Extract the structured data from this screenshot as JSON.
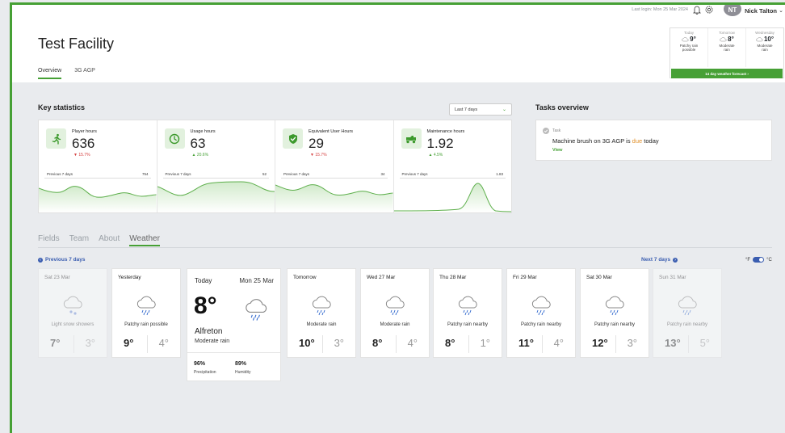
{
  "header": {
    "last_login": "Last login: Mon 25 Mar 2024",
    "avatar_initials": "NT",
    "user_name": "Nick Talton",
    "page_title": "Test Facility",
    "tabs": [
      {
        "label": "Overview"
      },
      {
        "label": "3G AGP"
      }
    ]
  },
  "weather_mini": {
    "days": [
      {
        "name": "Today",
        "temp": "9°",
        "desc1": "Patchy rain",
        "desc2": "possible"
      },
      {
        "name": "Tomorrow",
        "temp": "8°",
        "desc1": "Moderate",
        "desc2": "rain"
      },
      {
        "name": "Wednesday",
        "temp": "10°",
        "desc1": "Moderate",
        "desc2": "rain"
      }
    ],
    "forecast_button": "14 day weather forecast  ›"
  },
  "key_stats": {
    "title": "Key statistics",
    "period": "Last 7 days",
    "items": [
      {
        "label": "Player hours",
        "value": "636",
        "delta": "▼ 15.7%",
        "prev_label": "Previous 7 days",
        "prev_value": "754",
        "icon": "running-icon"
      },
      {
        "label": "Usage hours",
        "value": "63",
        "delta": "▲ 20.6%",
        "prev_label": "Previous 7 days",
        "prev_value": "52",
        "icon": "clock-icon"
      },
      {
        "label": "Equivalent User Hours",
        "value": "29",
        "delta": "▼ 15.7%",
        "prev_label": "Previous 7 days",
        "prev_value": "34",
        "icon": "shield-check-icon"
      },
      {
        "label": "Maintenance hours",
        "value": "1.92",
        "delta": "▲ 4.5%",
        "prev_label": "Previous 7 days",
        "prev_value": "1.83",
        "icon": "mower-icon"
      }
    ]
  },
  "tasks": {
    "title": "Tasks overview",
    "kind": "Task",
    "text_before": "Machine brush on 3G AGP is ",
    "text_due": "due",
    "text_after": " today",
    "view": "View"
  },
  "detail_tabs": [
    {
      "label": "Fields"
    },
    {
      "label": "Team"
    },
    {
      "label": "About"
    },
    {
      "label": "Weather"
    }
  ],
  "weather": {
    "prev_label": "Previous 7 days",
    "next_label": "Next 7 days",
    "unit_f": "°F",
    "unit_c": "°C",
    "days": [
      {
        "name": "Sat 23 Mar",
        "desc": "Light snow showers",
        "hi": "7°",
        "lo": "3°"
      },
      {
        "name": "Yesterday",
        "desc": "Patchy rain possible",
        "hi": "9°",
        "lo": "4°"
      },
      {
        "name": "Tomorrow",
        "desc": "Moderate rain",
        "hi": "10°",
        "lo": "3°"
      },
      {
        "name": "Wed 27 Mar",
        "desc": "Moderate rain",
        "hi": "8°",
        "lo": "4°"
      },
      {
        "name": "Thu 28 Mar",
        "desc": "Patchy rain nearby",
        "hi": "8°",
        "lo": "1°"
      },
      {
        "name": "Fri 29 Mar",
        "desc": "Patchy rain nearby",
        "hi": "11°",
        "lo": "4°"
      },
      {
        "name": "Sat 30 Mar",
        "desc": "Patchy rain nearby",
        "hi": "12°",
        "lo": "3°"
      },
      {
        "name": "Sun 31 Mar",
        "desc": "Patchy rain nearby",
        "hi": "13°",
        "lo": "5°"
      }
    ],
    "today": {
      "label": "Today",
      "date": "Mon 25 Mar",
      "temp": "8°",
      "place": "Alfreton",
      "desc": "Moderate rain",
      "precipitation": "96%",
      "precipitation_label": "Precipitation",
      "humidity": "89%",
      "humidity_label": "Humidity"
    }
  },
  "colors": {
    "accent": "#46a035",
    "link": "#3a5db0",
    "down": "#d43d3d",
    "due": "#e0902a"
  }
}
